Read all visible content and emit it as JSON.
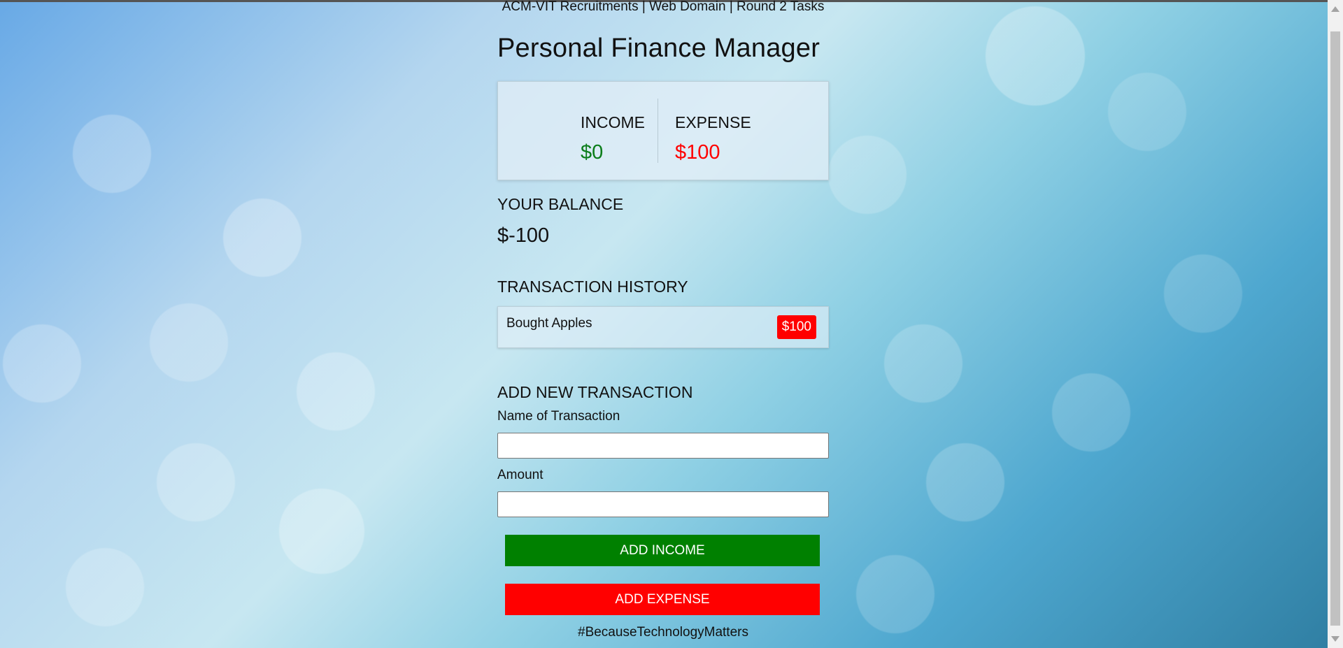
{
  "header": {
    "subtitle": "ACM-VIT Recruitments | Web Domain | Round 2 Tasks",
    "title": "Personal Finance Manager"
  },
  "summary": {
    "income_label": "INCOME",
    "income_value": "$0",
    "expense_label": "EXPENSE",
    "expense_value": "$100"
  },
  "balance": {
    "label": "YOUR BALANCE",
    "value": "$-100"
  },
  "history": {
    "label": "TRANSACTION HISTORY",
    "items": [
      {
        "name": "Bought Apples",
        "amount": "$100",
        "type": "expense"
      }
    ]
  },
  "add_transaction": {
    "label": "ADD NEW TRANSACTION",
    "name_label": "Name of Transaction",
    "name_value": "",
    "amount_label": "Amount",
    "amount_value": "",
    "income_button": "ADD INCOME",
    "expense_button": "ADD EXPENSE"
  },
  "footer": {
    "text": "#BecauseTechnologyMatters"
  },
  "colors": {
    "income": "#008000",
    "expense": "#ff0000"
  }
}
